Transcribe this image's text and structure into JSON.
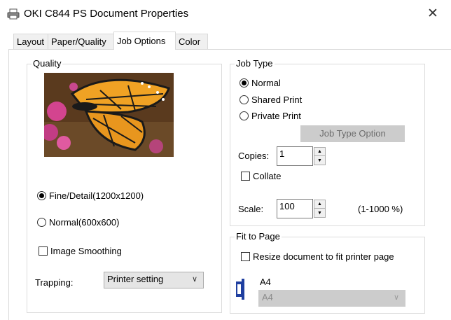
{
  "window": {
    "title": "OKI C844 PS Document Properties",
    "close_glyph": "✕"
  },
  "tabs": [
    {
      "label": "Layout"
    },
    {
      "label": "Paper/Quality"
    },
    {
      "label": "Job Options",
      "active": true
    },
    {
      "label": "Color"
    }
  ],
  "quality": {
    "legend": "Quality",
    "options": [
      {
        "label": "Fine/Detail(1200x1200)",
        "selected": true
      },
      {
        "label": "Normal(600x600)",
        "selected": false
      }
    ],
    "image_smoothing": {
      "label": "Image Smoothing",
      "checked": false
    },
    "trapping": {
      "label": "Trapping:",
      "value": "Printer setting"
    }
  },
  "job_type": {
    "legend": "Job Type",
    "options": [
      {
        "label": "Normal",
        "selected": true
      },
      {
        "label": "Shared Print",
        "selected": false
      },
      {
        "label": "Private Print",
        "selected": false
      }
    ],
    "option_button": "Job Type Option",
    "copies": {
      "label": "Copies:",
      "value": "1"
    },
    "collate": {
      "label": "Collate",
      "checked": false
    },
    "scale": {
      "label": "Scale:",
      "value": "100",
      "range": "(1-1000 %)"
    }
  },
  "fit_to_page": {
    "legend": "Fit to Page",
    "resize": {
      "label": "Resize document to fit printer page",
      "checked": false
    },
    "paper_label": "A4",
    "paper_select": "A4"
  },
  "icons": [
    "printer-icon",
    "close-icon",
    "portrait-orientation-icon",
    "chevron-down-icon",
    "spin-up-icon",
    "spin-down-icon"
  ],
  "colors": {
    "disabled_button": "#cccccc",
    "orientation_icon": "#1f3fa0"
  }
}
